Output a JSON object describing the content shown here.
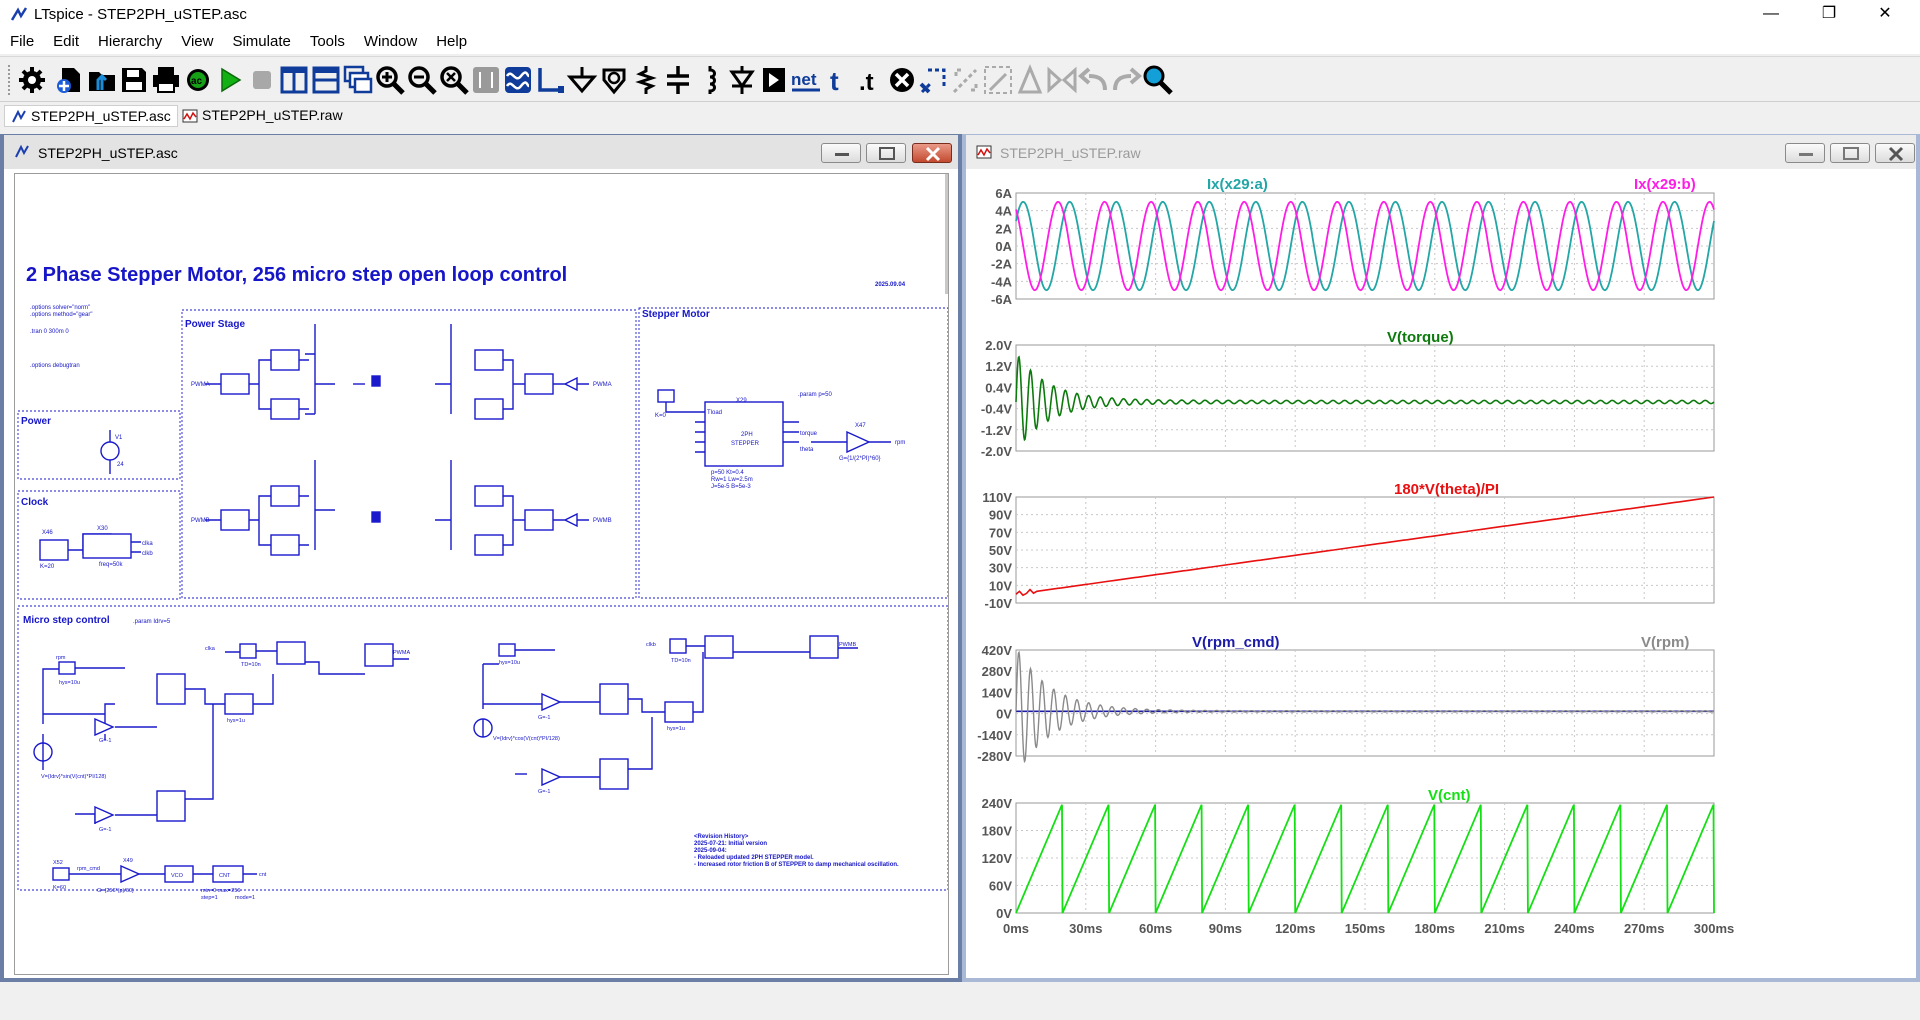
{
  "app": {
    "title": "LTspice - STEP2PH_uSTEP.asc",
    "controls": {
      "minimize": "—",
      "restore": "❐",
      "close": "✕"
    }
  },
  "menu": [
    "File",
    "Edit",
    "Hierarchy",
    "View",
    "Simulate",
    "Tools",
    "Window",
    "Help"
  ],
  "toolbar_text": {
    "net": "net",
    "text": "t"
  },
  "tabs": [
    {
      "label": "STEP2PH_uSTEP.asc",
      "active": true
    },
    {
      "label": "STEP2PH_uSTEP.raw",
      "active": false
    }
  ],
  "schematic": {
    "window_title": "STEP2PH_uSTEP.asc",
    "title": "2 Phase Stepper Motor, 256 micro step open loop control",
    "date": "2025.09.04",
    "options": [
      ".options solver=\"norm\"",
      ".options method=\"gear\"",
      ".tran 0 300m 0",
      ".options debugtran"
    ],
    "sections": {
      "power_stage": "Power Stage",
      "stepper_motor": "Stepper Motor",
      "power": "Power",
      "clock": "Clock",
      "micro_step": "Micro step control",
      "micro_param": ".param Idrv=5"
    },
    "labels": {
      "pwma": "PWMA",
      "pwmb": "PWMB",
      "v1": "V1",
      "v1_val": "24",
      "x46": "X46",
      "x46_k": "K=20",
      "x30": "X30",
      "freq": "freq=50k",
      "clka": "clka",
      "clkb": "clkb",
      "x29": "X29",
      "stepper": "STEPPER",
      "twoph": "2PH",
      "param_p": ".param p=50",
      "stepper_params_1": "p=50 Kt=0.4",
      "stepper_params_2": "Rw=1 Lw=2.5m",
      "stepper_params_3": "J=5e-5 B=5e-3",
      "x47": "X47",
      "x47_g": "G={1/(2*PI)*60}",
      "rpm": "rpm",
      "tload": "Tload",
      "torque": "torque",
      "theta": "theta",
      "k0": "K=0",
      "b1_expr": "V={Idrv}*sin(V(cnt)*PI/128)",
      "b2_expr": "V={Idrv}*cos(V(cnt)*PI/128)",
      "hys": "hys=10u",
      "hys1u": "hys=1u",
      "td": "TD=10n",
      "g1": "G=-1",
      "x52": "X52",
      "k60": "K=60",
      "rpm_cmd": "rpm_cmd",
      "x49": "X49",
      "x49_g": "G={256*(p)/60}",
      "vco": "VCO",
      "cnt": "CNT",
      "cnt_out": "cnt",
      "cnt_params_1": "min=0 max=256",
      "cnt_params_2": "step=1",
      "cnt_params_3": "mode=1"
    },
    "revision": [
      "<Revision History>",
      "2025-07-21: Initial version",
      "2025-09-04:",
      "- Reloaded updated 2PH STEPPER model.",
      "- Increased rotor friction B of STEPPER to damp mechanical oscillation."
    ]
  },
  "waveform": {
    "window_title": "STEP2PH_uSTEP.raw",
    "colors": {
      "teal": "#22a6a6",
      "magenta": "#ff1ce6",
      "green": "#0d7a0d",
      "red": "#e81010",
      "navy": "#1c1ca8",
      "gray": "#8a8a8a",
      "lime": "#13e013"
    }
  },
  "chart_data": [
    {
      "type": "line",
      "title": "",
      "series": [
        {
          "name": "Ix(x29:a)",
          "color": "#22a6a6",
          "amplitude": 5,
          "cycles": 15
        },
        {
          "name": "Ix(x29:b)",
          "color": "#ff1ce6",
          "amplitude": 5,
          "cycles": 15
        }
      ],
      "yticks": [
        "6A",
        "4A",
        "2A",
        "0A",
        "-2A",
        "-4A",
        "-6A"
      ],
      "ylim": [
        -6,
        6
      ]
    },
    {
      "type": "line",
      "series": [
        {
          "name": "V(torque)",
          "color": "#0d7a0d",
          "final": -0.15,
          "peak": 1.8
        }
      ],
      "yticks": [
        "2.0V",
        "1.2V",
        "0.4V",
        "-0.4V",
        "-1.2V",
        "-2.0V"
      ],
      "ylim": [
        -2.0,
        2.0
      ]
    },
    {
      "type": "line",
      "series": [
        {
          "name": "180*V(theta)/PI",
          "color": "#e81010",
          "start": 0,
          "end": 110
        }
      ],
      "yticks": [
        "110V",
        "90V",
        "70V",
        "50V",
        "30V",
        "10V",
        "-10V"
      ],
      "ylim": [
        -10,
        110
      ]
    },
    {
      "type": "line",
      "series": [
        {
          "name": "V(rpm_cmd)",
          "color": "#1c1ca8",
          "value": 15
        },
        {
          "name": "V(rpm)",
          "color": "#8a8a8a",
          "value": 15,
          "peak": 420
        }
      ],
      "yticks": [
        "420V",
        "280V",
        "140V",
        "0V",
        "-140V",
        "-280V"
      ],
      "ylim": [
        -280,
        420
      ]
    },
    {
      "type": "line",
      "series": [
        {
          "name": "V(cnt)",
          "color": "#13e013",
          "max": 256,
          "cycles": 15
        }
      ],
      "yticks": [
        "240V",
        "180V",
        "120V",
        "60V",
        "0V"
      ],
      "ylim": [
        0,
        260
      ],
      "xticks": [
        "0ms",
        "30ms",
        "60ms",
        "90ms",
        "120ms",
        "150ms",
        "180ms",
        "210ms",
        "240ms",
        "270ms",
        "300ms"
      ],
      "xlim": [
        0,
        300
      ]
    }
  ]
}
